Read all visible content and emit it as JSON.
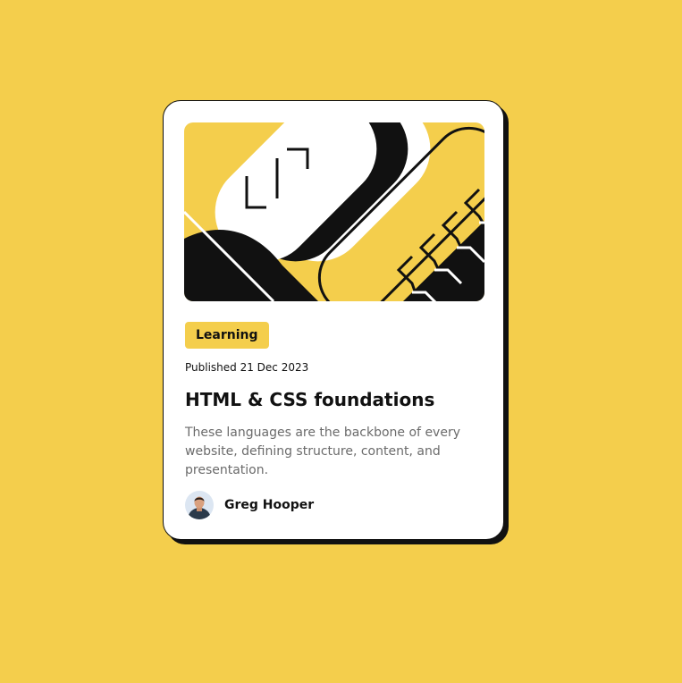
{
  "colors": {
    "background": "#F4CE4C",
    "card": "#FFFFFF",
    "ink": "#111111",
    "muted": "#6B6B6B",
    "tag_bg": "#F4CE4C"
  },
  "card": {
    "illustration_icon": "abstract-code-illustration",
    "tag": "Learning",
    "published": "Published 21 Dec 2023",
    "title": "HTML & CSS foundations",
    "description": "These languages are the backbone of every website, defining structure, content, and presentation.",
    "author": {
      "name": "Greg Hooper",
      "avatar_icon": "author-avatar"
    }
  }
}
